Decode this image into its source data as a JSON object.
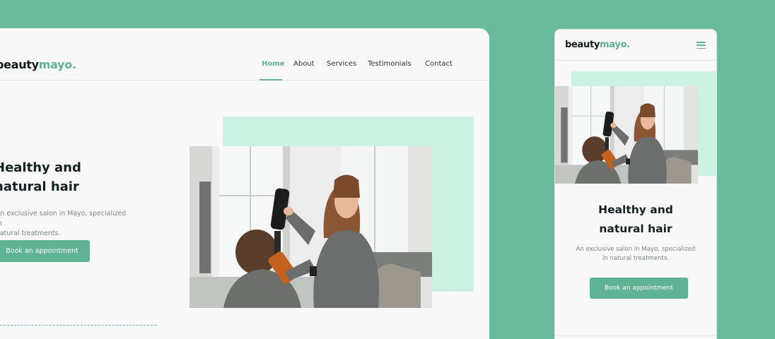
{
  "brand": {
    "logo_dark": "beauty",
    "logo_accent": "mayo.",
    "accent_color": "#5fb294",
    "background_color": "#6aba9c",
    "mint_color": "#ccf2e3"
  },
  "nav": {
    "items": [
      {
        "label": "Home",
        "active": true
      },
      {
        "label": "About",
        "active": false
      },
      {
        "label": "Services",
        "active": false
      },
      {
        "label": "Testimonials",
        "active": false
      },
      {
        "label": "Contact",
        "active": false
      }
    ]
  },
  "hero": {
    "desktop_title": "Healthy and\nnatural hair",
    "desktop_subtitle": "An exclusive salon in Mayo, specialized in\nnatural treatments.",
    "mobile_title": "Healthy and\nnatural hair",
    "mobile_subtitle": "An exclusive salon in Mayo, specialized\nin natural treatments.",
    "cta_label": "Book an appointment"
  },
  "icons": {
    "menu": "hamburger-menu-icon"
  }
}
